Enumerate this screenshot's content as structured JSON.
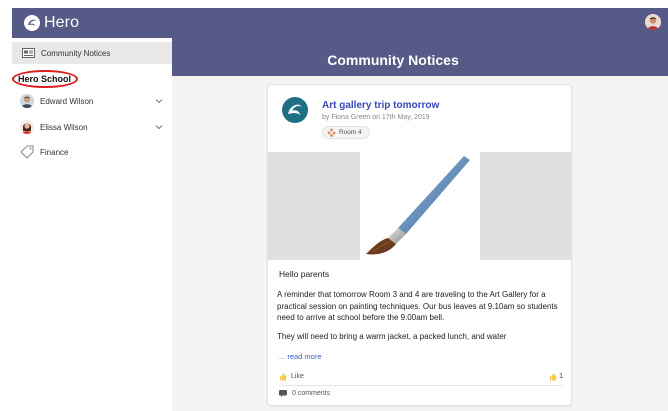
{
  "brand": {
    "name": "Hero"
  },
  "sidebar": {
    "active_item": "Community Notices",
    "school_name": "Hero School",
    "people": [
      {
        "name": "Edward Wilson"
      },
      {
        "name": "Elissa Wilson"
      }
    ],
    "finance_label": "Finance"
  },
  "main": {
    "title": "Community Notices"
  },
  "notice": {
    "title": "Art gallery trip tomorrow",
    "meta": "by Fiona Green on 17th May, 2019",
    "tag": "Room 4",
    "greeting": "Hello parents",
    "paragraph1": "A reminder that tomorrow Room 3 and 4 are traveling to the Art Gallery for a practical session on painting techniques. Our bus leaves at 9.10am so students need to arrive at school before the 9.00am bell.",
    "paragraph2": "They will need to bring a warm jacket, a packed lunch, and water",
    "read_more": "... read more",
    "like_label": "Like",
    "like_count": "1",
    "comments_label": "0 comments"
  },
  "colors": {
    "header": "#555a86",
    "link": "#3847b8",
    "highlight_circle": "#d91e1e",
    "logo_teal": "#1f6f84"
  }
}
